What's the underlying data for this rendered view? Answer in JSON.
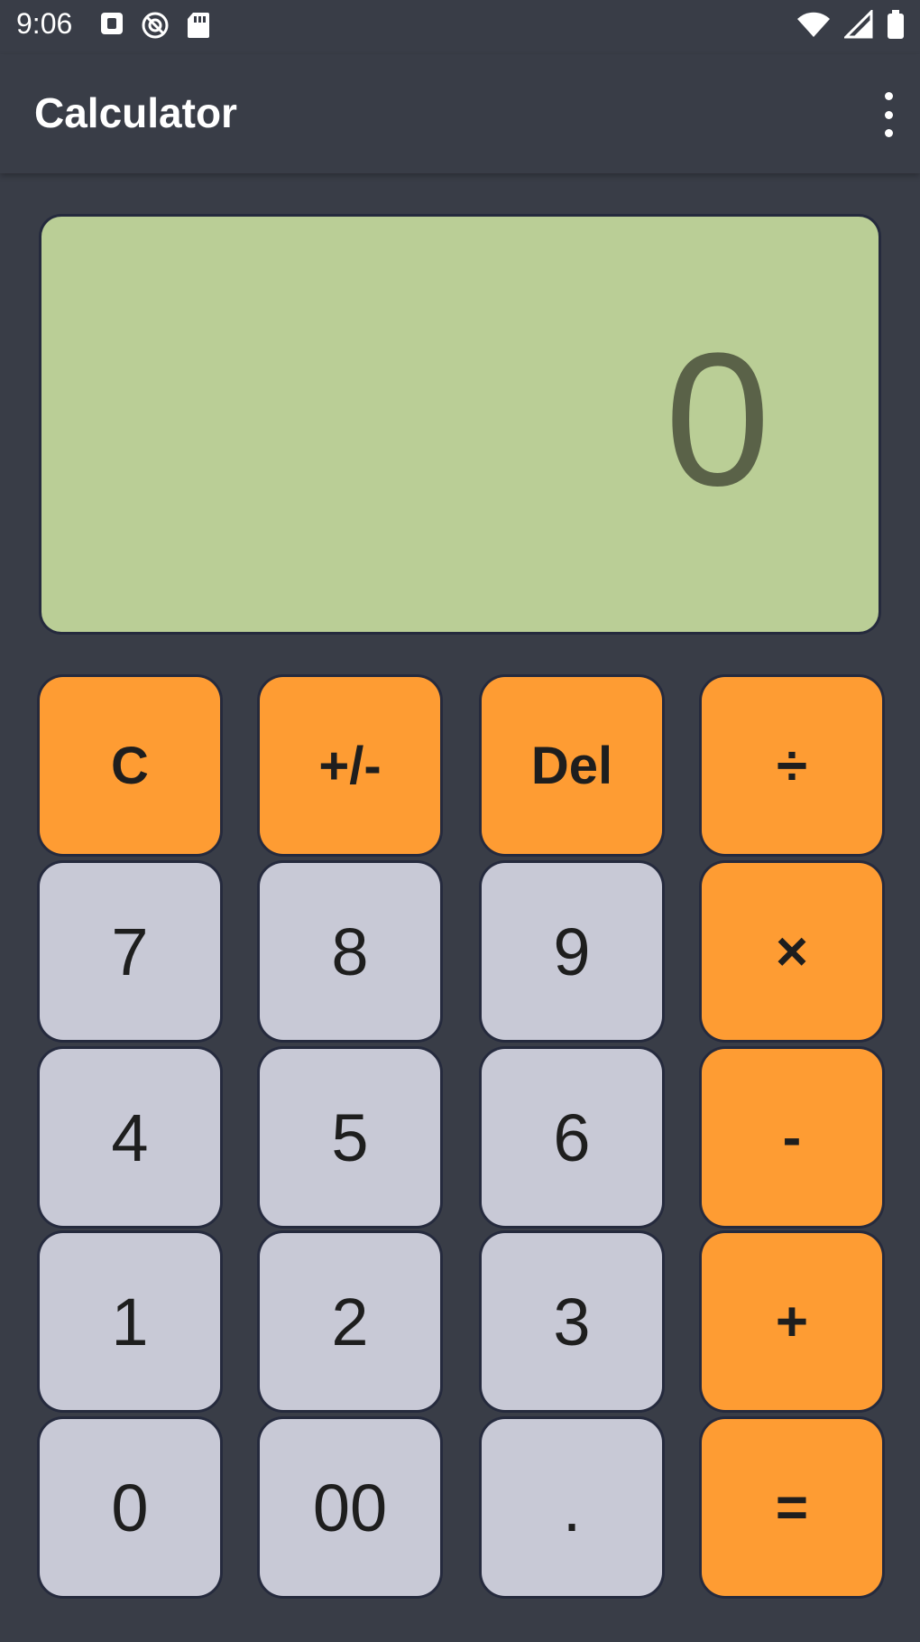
{
  "status_bar": {
    "time": "9:06"
  },
  "app_bar": {
    "title": "Calculator"
  },
  "display": {
    "value": "0"
  },
  "keys": {
    "clear": "C",
    "negate": "+/-",
    "delete": "Del",
    "divide": "÷",
    "seven": "7",
    "eight": "8",
    "nine": "9",
    "multiply": "×",
    "four": "4",
    "five": "5",
    "six": "6",
    "subtract": "-",
    "one": "1",
    "two": "2",
    "three": "3",
    "add": "+",
    "zero": "0",
    "double_zero": "00",
    "decimal": ".",
    "equals": "="
  },
  "colors": {
    "background": "#393d47",
    "display": "#bace96",
    "display_text": "#5a6248",
    "operator_key": "#fe9c33",
    "digit_key": "#c8c9d6"
  },
  "icons": {
    "status_left": [
      "notification-icon",
      "sync-icon",
      "sd-card-icon"
    ],
    "status_right": [
      "wifi-icon",
      "cell-signal-icon",
      "battery-icon"
    ],
    "menu": "more-vert-icon"
  }
}
